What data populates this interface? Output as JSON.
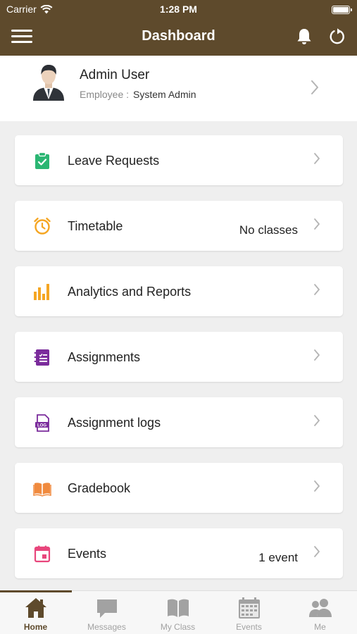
{
  "status_bar": {
    "carrier": "Carrier",
    "time": "1:28 PM"
  },
  "header": {
    "title": "Dashboard"
  },
  "profile": {
    "name": "Admin User",
    "role_label": "Employee :",
    "role_value": "System Admin"
  },
  "menu": [
    {
      "label": "Leave Requests",
      "meta": "",
      "icon": "clipboard-check-icon",
      "color": "#2bb673"
    },
    {
      "label": "Timetable",
      "meta": "No classes",
      "icon": "alarm-clock-icon",
      "color": "#f5a623"
    },
    {
      "label": "Analytics and Reports",
      "meta": "",
      "icon": "bar-chart-icon",
      "color": "#f5a623"
    },
    {
      "label": "Assignments",
      "meta": "",
      "icon": "assignment-icon",
      "color": "#7b2c9c"
    },
    {
      "label": "Assignment logs",
      "meta": "",
      "icon": "log-file-icon",
      "color": "#7b2c9c"
    },
    {
      "label": "Gradebook",
      "meta": "",
      "icon": "open-book-icon",
      "color": "#f08a3e"
    },
    {
      "label": "Events",
      "meta": "1 event",
      "icon": "calendar-icon",
      "color": "#e8467c"
    }
  ],
  "tabs": [
    {
      "label": "Home",
      "icon": "home-icon",
      "active": true
    },
    {
      "label": "Messages",
      "icon": "chat-bubble-icon",
      "active": false
    },
    {
      "label": "My Class",
      "icon": "book-icon",
      "active": false
    },
    {
      "label": "Events",
      "icon": "calendar-icon",
      "active": false
    },
    {
      "label": "Me",
      "icon": "people-icon",
      "active": false
    }
  ],
  "colors": {
    "header_bg": "#5e4a2c",
    "page_bg": "#efefef",
    "tab_inactive": "#a2a2a2"
  }
}
